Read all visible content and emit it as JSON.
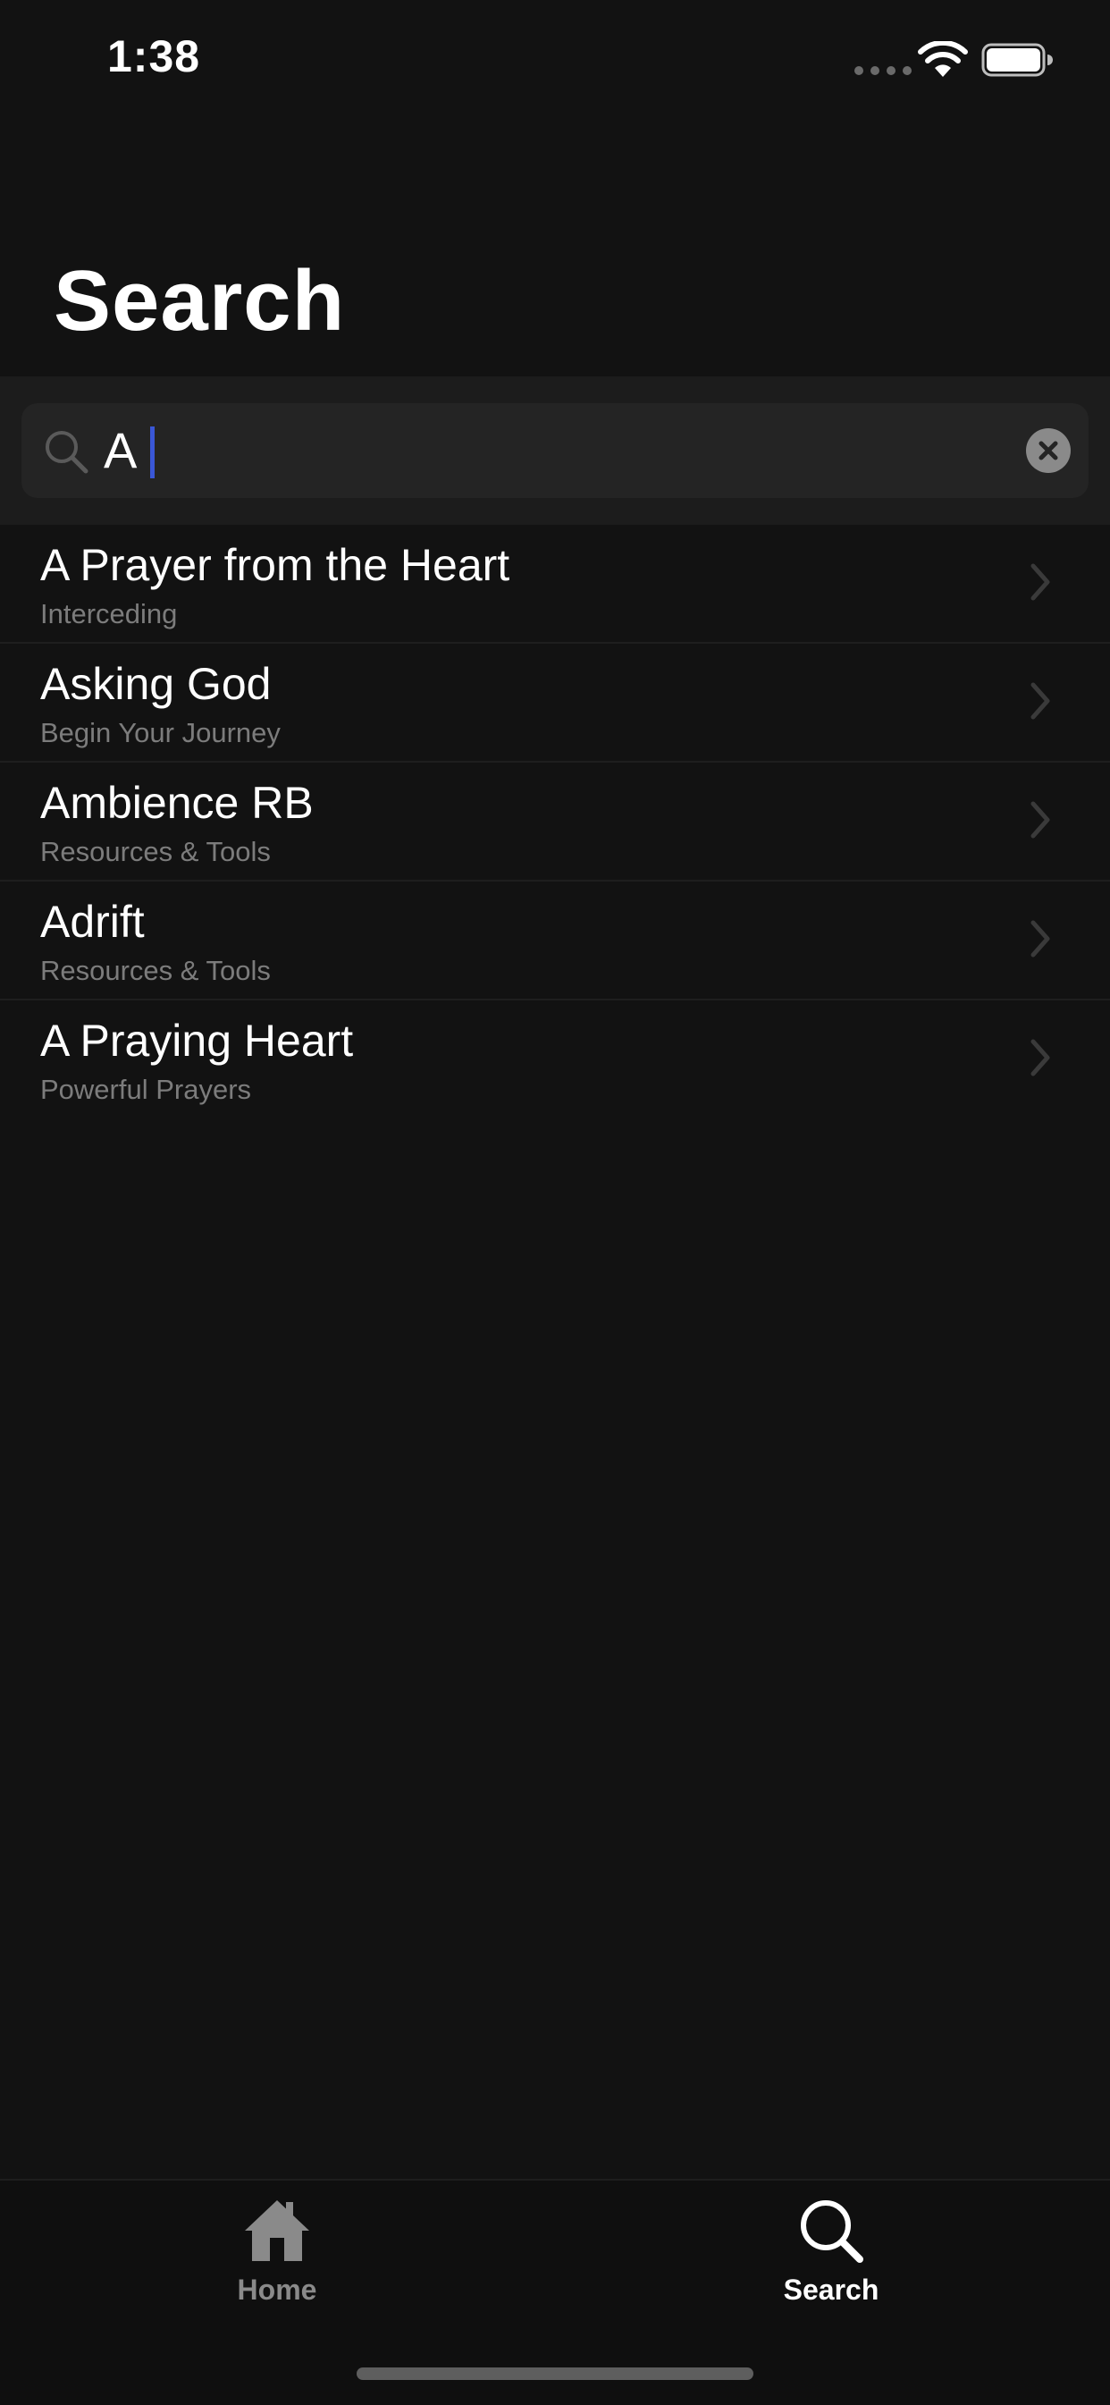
{
  "status_bar": {
    "time": "1:38"
  },
  "header": {
    "title": "Search"
  },
  "search": {
    "value": "A",
    "placeholder": ""
  },
  "results": [
    {
      "title": "A Prayer from the Heart",
      "subtitle": "Interceding"
    },
    {
      "title": "Asking God",
      "subtitle": "Begin Your Journey"
    },
    {
      "title": "Ambience RB",
      "subtitle": "Resources & Tools"
    },
    {
      "title": "Adrift",
      "subtitle": "Resources & Tools"
    },
    {
      "title": "A Praying Heart",
      "subtitle": "Powerful Prayers"
    }
  ],
  "tab_bar": {
    "home_label": "Home",
    "search_label": "Search",
    "active_tab": "search"
  },
  "colors": {
    "background": "#121212",
    "caret": "#3a57d6",
    "subtitle": "#7c7c7c",
    "inactive_tab": "#8a8a8a"
  },
  "icons": {
    "search_field": "search-icon",
    "clear": "clear-icon",
    "row_chevron": "chevron-right-icon",
    "home_tab": "home-icon",
    "search_tab": "search-icon"
  }
}
